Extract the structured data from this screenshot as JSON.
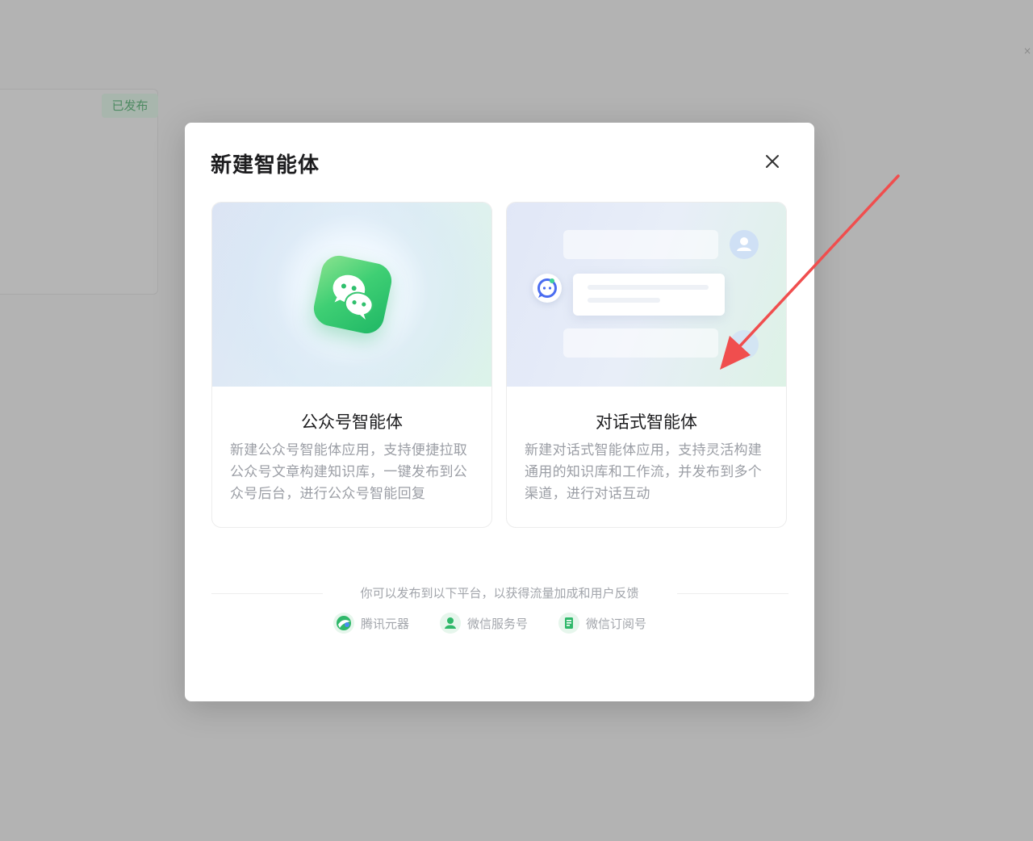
{
  "background": {
    "badge_label": "已发布",
    "close_glyph": "×"
  },
  "modal": {
    "title": "新建智能体",
    "close_icon": "close-icon"
  },
  "cards": [
    {
      "title": "公众号智能体",
      "description": "新建公众号智能体应用，支持便捷拉取公众号文章构建知识库，一键发布到公众号后台，进行公众号智能回复",
      "icon": "wechat-icon"
    },
    {
      "title": "对话式智能体",
      "description": "新建对话式智能体应用，支持灵活构建通用的知识库和工作流，并发布到多个渠道，进行对话互动",
      "icon": "chat-icon"
    }
  ],
  "footer": {
    "text": "你可以发布到以下平台，以获得流量加成和用户反馈",
    "platforms": [
      {
        "label": "腾讯元器",
        "icon": "yuanqi-icon",
        "color": "#2fb86a"
      },
      {
        "label": "微信服务号",
        "icon": "service-account-icon",
        "color": "#2fb86a"
      },
      {
        "label": "微信订阅号",
        "icon": "subscription-account-icon",
        "color": "#2fb86a"
      }
    ]
  },
  "colors": {
    "accent_green": "#2fb86a",
    "annotation_arrow": "#f04e4e"
  }
}
